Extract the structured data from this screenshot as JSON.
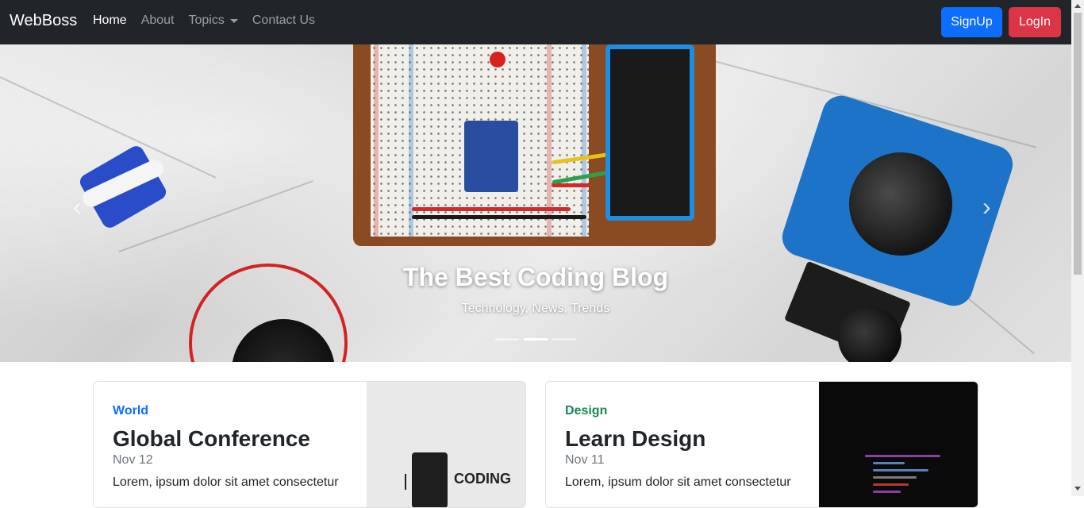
{
  "navbar": {
    "brand": "WebBoss",
    "links": [
      {
        "label": "Home",
        "active": true
      },
      {
        "label": "About",
        "active": false
      },
      {
        "label": "Topics",
        "active": false,
        "dropdown": true
      },
      {
        "label": "Contact Us",
        "active": false
      }
    ],
    "signup_label": "SignUp",
    "login_label": "LogIn"
  },
  "hero": {
    "title": "The Best Coding Blog",
    "subtitle": "Technology, News, Trends",
    "indicator_count": 3,
    "active_indicator": 1,
    "prev_icon": "chevron-left-icon",
    "next_icon": "chevron-right-icon"
  },
  "cards": [
    {
      "category": "World",
      "category_color": "#0d6efd",
      "title": "Global Conference",
      "date": "Nov 12",
      "excerpt": "Lorem, ipsum dolor sit amet consectetur",
      "thumb_text": "CODING"
    },
    {
      "category": "Design",
      "category_color": "#198754",
      "title": "Learn Design",
      "date": "Nov 11",
      "excerpt": "Lorem, ipsum dolor sit amet consectetur"
    }
  ],
  "colors": {
    "navbar_bg": "#212529",
    "signup_bg": "#0d6efd",
    "login_bg": "#dc3545"
  }
}
